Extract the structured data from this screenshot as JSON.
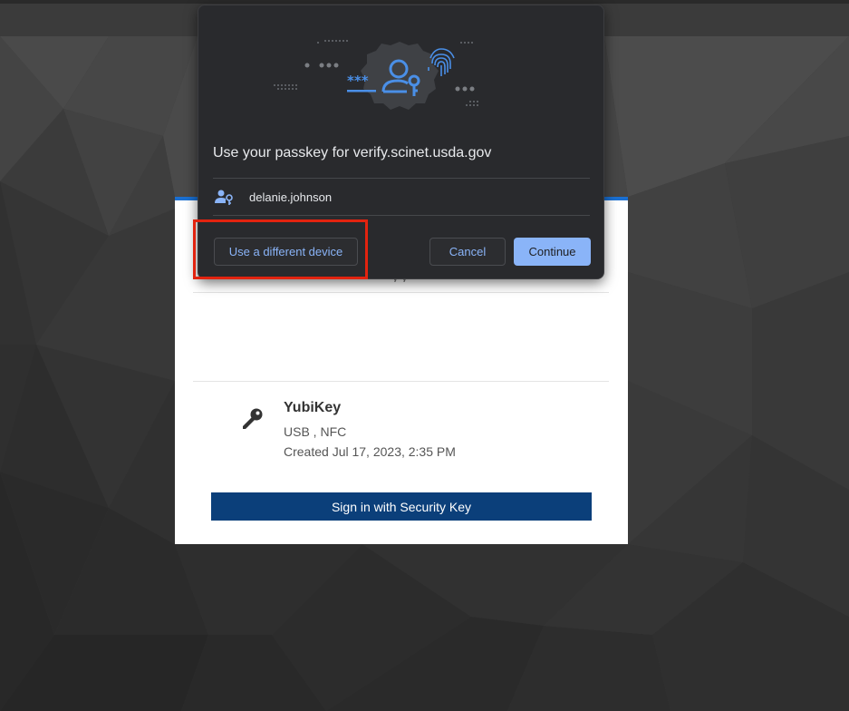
{
  "dialog": {
    "title": "Use your passkey for verify.scinet.usda.gov",
    "account": "delanie.johnson",
    "buttons": {
      "different_device": "Use a different device",
      "cancel": "Cancel",
      "continue": "Continue"
    },
    "illustration": {
      "password_mask": "***",
      "icons": [
        "user-key-icon",
        "fingerprint-icon"
      ]
    }
  },
  "card": {
    "accent_color": "#1a6fd1",
    "security_key": {
      "icon": "key-icon",
      "name": "YubiKey",
      "transports": "USB , NFC",
      "created": "Created Jul 17, 2023, 2:35 PM"
    },
    "sign_in_button": "Sign in with Security Key"
  },
  "colors": {
    "dialog_bg": "#292a2d",
    "link_blue": "#8ab4f8",
    "primary_button": "#8ab4f8",
    "sign_in_button": "#0b3f7a",
    "highlight": "#e2230f"
  }
}
